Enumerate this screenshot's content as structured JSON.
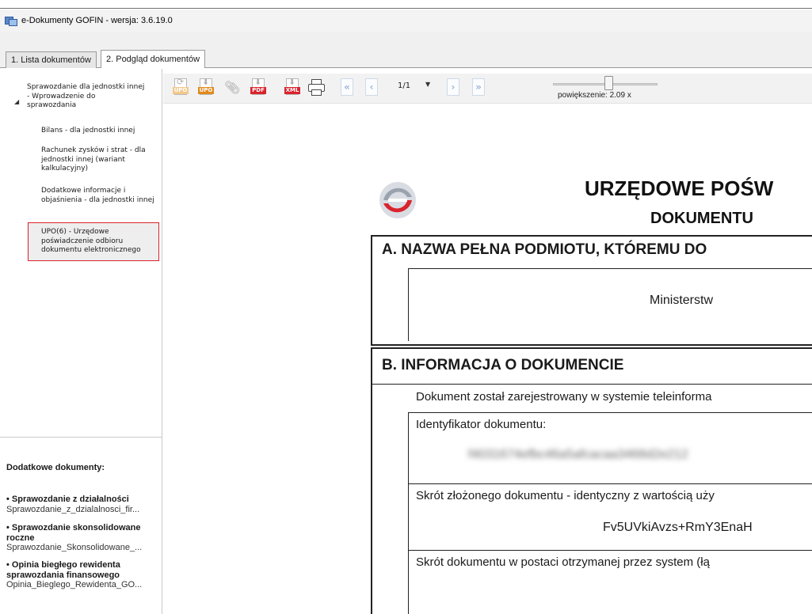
{
  "window": {
    "title": "e-Dokumenty GOFIN - wersja: 3.6.19.0"
  },
  "tabs": [
    {
      "label": "1. Lista dokumentów"
    },
    {
      "label": "2. Podgląd dokumentów"
    }
  ],
  "tree": {
    "parent": "Sprawozdanie dla jednostki innej - Wprowadzenie do sprawozdania",
    "children": [
      "Bilans - dla jednostki innej",
      "Rachunek zysków i strat - dla jednostki innej (wariant kalkulacyjny)",
      "Dodatkowe informacje i objaśnienia - dla jednostki innej",
      "UPO(6) - Urzędowe poświadczenie odbioru dokumentu elektronicznego"
    ],
    "selected_index": 3
  },
  "extra_docs": {
    "title": "Dodatkowe dokumenty:",
    "items": [
      {
        "name": "• Sprawozdanie z działalności",
        "file": "Sprawozdanie_z_dzialalnosci_fir..."
      },
      {
        "name": "• Sprawozdanie skonsolidowane roczne",
        "file": "Sprawozdanie_Skonsolidowane_..."
      },
      {
        "name": "• Opinia biegłego rewidenta sprawozdania finansowego",
        "file": "Opinia_Bieglego_Rewidenta_GO..."
      }
    ]
  },
  "toolbar": {
    "icons": [
      "upo-refresh-icon",
      "upo-download-icon",
      "paperclip-icon",
      "pdf-download-icon",
      "xml-download-icon",
      "printer-icon",
      "first-page-icon",
      "prev-page-icon",
      "next-page-icon",
      "last-page-icon"
    ],
    "icon_labels": {
      "upo": "UPO",
      "pdf": "PDF",
      "xml": "XML"
    },
    "page": "1/1",
    "zoom_label": "powiększenie: 2.09 x"
  },
  "document": {
    "heading1": "URZĘDOWE POŚW",
    "heading2": "DOKUMENTU",
    "sectionA": {
      "title": "A. NAZWA PEŁNA PODMIOTU, KTÓREMU DO",
      "value": "Ministerstw"
    },
    "sectionB": {
      "title": "B. INFORMACJA O DOKUMENCIE",
      "intro": "Dokument został zarejestrowany w systemie teleinforma",
      "fields": [
        {
          "label": "Identyfikator dokumentu:",
          "value": "f4031674efbc46a5afcacaa3468d2e212"
        },
        {
          "label": "Skrót złożonego dokumentu - identyczny z wartością uży",
          "value": "Fv5UVkiAvzs+RmY3EnaH"
        },
        {
          "label": "Skrót dokumentu w postaci otrzymanej przez system (łą",
          "value": ""
        }
      ]
    }
  },
  "colors": {
    "selection_border": "#d9232d",
    "pdf_xml_label": "#d9232d",
    "upo_label": "#e08a1c"
  }
}
